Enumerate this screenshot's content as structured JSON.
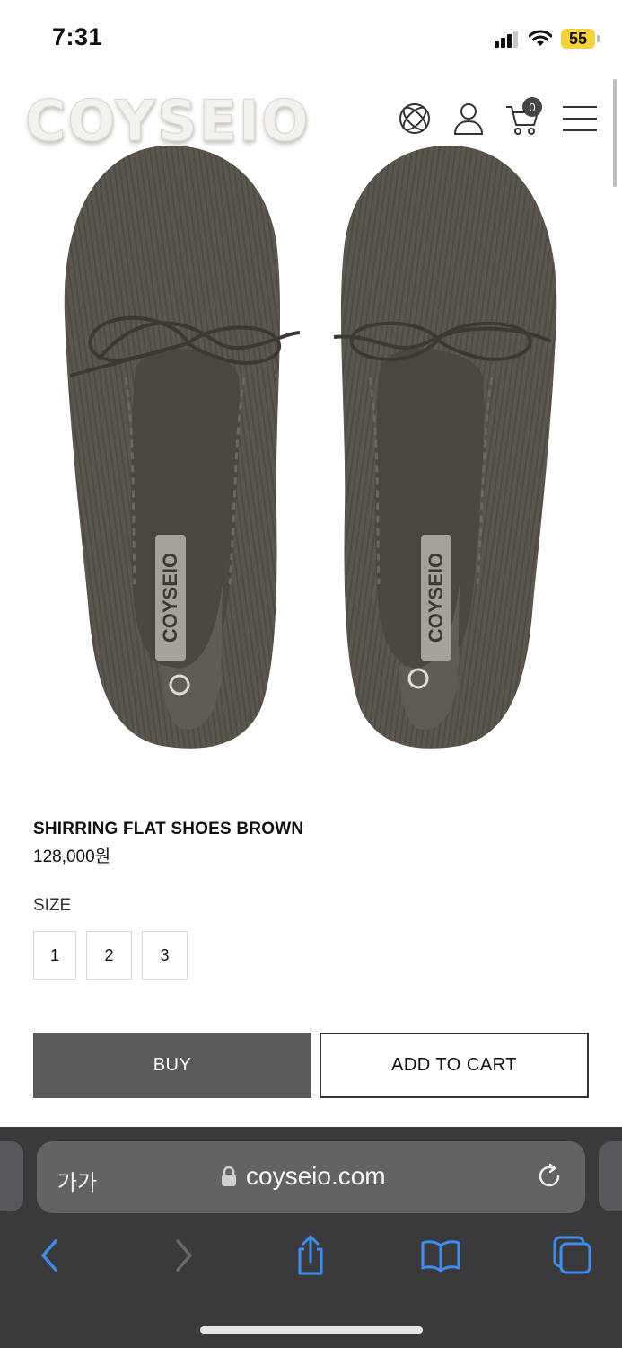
{
  "status": {
    "time": "7:31",
    "battery": "55"
  },
  "header": {
    "logo": "COYSEIO",
    "cart_count": "0"
  },
  "product": {
    "title": "SHIRRING FLAT SHOES BROWN",
    "price": "128,000원",
    "size_label": "SIZE",
    "sizes": [
      "1",
      "2",
      "3"
    ],
    "insole_text": "COYSEIO",
    "buy_label": "BUY",
    "cart_label": "ADD TO CART"
  },
  "browser": {
    "text_size": "가가",
    "url": "coyseio.com"
  },
  "colors": {
    "shoe": "#5a554d",
    "buy_button": "#595959",
    "browser_bar": "#3a3a3c",
    "link_blue": "#3d8ef0"
  }
}
